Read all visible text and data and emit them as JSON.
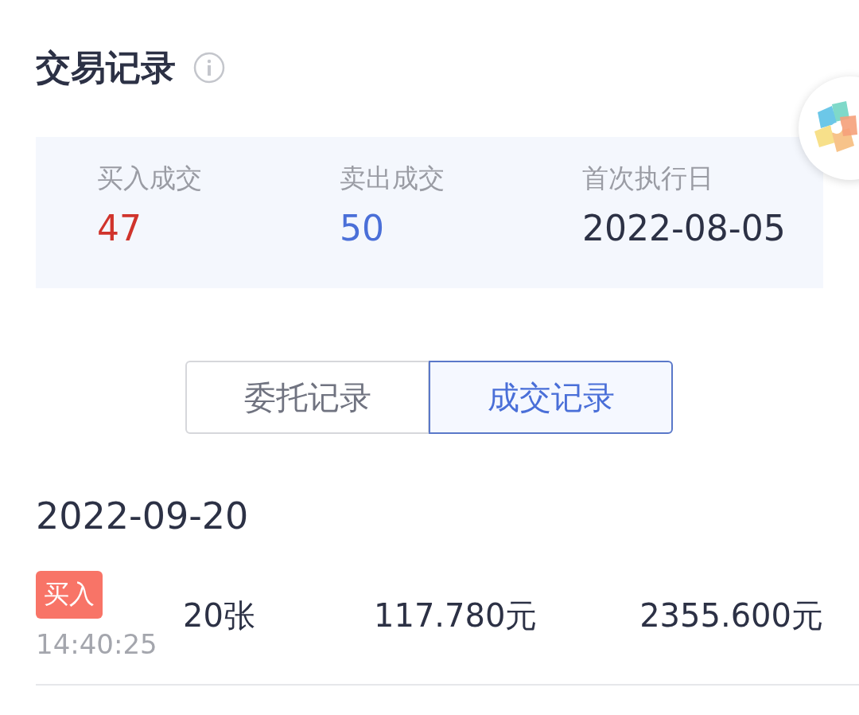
{
  "title": "交易记录",
  "summary": [
    {
      "label": "买入成交",
      "value": "47",
      "color": "#d0342c"
    },
    {
      "label": "卖出成交",
      "value": "50",
      "color": "#4a6fd8"
    },
    {
      "label": "首次执行日",
      "value": "2022-08-05",
      "color": "#2c3145"
    }
  ],
  "tabs": [
    {
      "label": "委托记录",
      "selected": false
    },
    {
      "label": "成交记录",
      "selected": true
    }
  ],
  "groups": [
    {
      "date": "2022-09-20",
      "trades": [
        {
          "kind": "buy",
          "side": "买入",
          "time": "14:40:25",
          "quantity": "20张",
          "price": "117.780元",
          "amount": "2355.600元"
        }
      ]
    }
  ]
}
